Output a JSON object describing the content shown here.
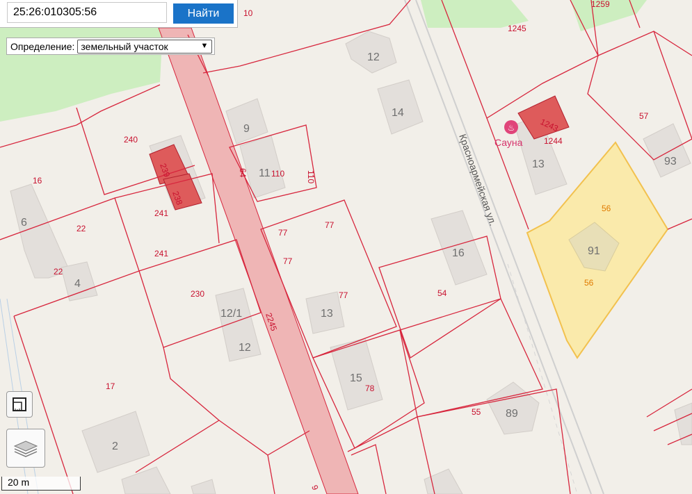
{
  "search": {
    "value": "25:26:010305:56",
    "button_label": "Найти"
  },
  "definition": {
    "label": "Определение:",
    "selected": "земельный участок"
  },
  "map": {
    "street_name": "Красноармейская ул.",
    "poi_name": "Сауна",
    "road_parcel": "2245",
    "selected_parcel": {
      "labels": [
        "56",
        "56"
      ],
      "building": "91",
      "fill": "#fbe9a4",
      "stroke": "#f2c14e"
    },
    "house_numbers": [
      "12",
      "14",
      "9",
      "11",
      "13",
      "6",
      "4",
      "16",
      "93",
      "91",
      "12/1",
      "12",
      "13",
      "15",
      "89",
      "2"
    ],
    "parcel_numbers": [
      "10",
      "1259",
      "1245",
      "240",
      "239",
      "238",
      "241",
      "241",
      "16",
      "22",
      "22",
      "110",
      "110",
      "64",
      "77",
      "77",
      "77",
      "77",
      "230",
      "1243",
      "1244",
      "57",
      "54",
      "78",
      "55",
      "17",
      "9"
    ],
    "colors": {
      "parcel_border": "#d7263d",
      "road": "#efb5b5",
      "park": "#cdeec0",
      "building": "#e3dfdb",
      "highlight_building": "#de5b5b"
    }
  },
  "controls": {
    "ruler": "ruler-icon",
    "layers": "layers-icon"
  },
  "scale": {
    "label": "20 m"
  }
}
